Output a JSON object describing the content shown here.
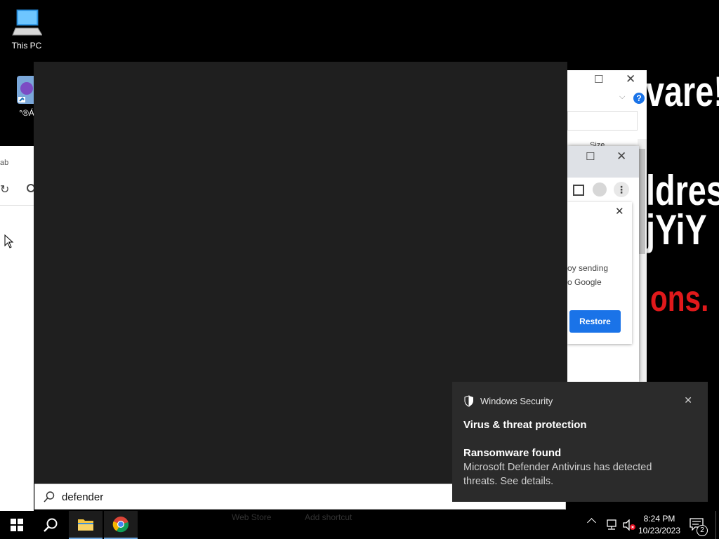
{
  "desktop": {
    "icons": [
      {
        "label": "This PC"
      },
      {
        "label": "°®Á"
      }
    ]
  },
  "wallpaper": {
    "lines": [
      "vare!",
      "ldres",
      "jYiY",
      "ons."
    ]
  },
  "background_windows": {
    "explorer_partial": {
      "column_size": "Size"
    },
    "chrome_partial": {
      "tab_text": "ab",
      "dialog_text_1": "oy sending",
      "dialog_text_2": "o Google",
      "restore_label": "Restore",
      "bookmarks": [
        "Web Store",
        "Add shortcut"
      ]
    }
  },
  "search": {
    "query": "defender"
  },
  "toast": {
    "app_name": "Windows Security",
    "title": "Virus & threat protection",
    "subtitle": "Ransomware found",
    "body": "Microsoft Defender Antivirus has detected threats.  See details."
  },
  "taskbar": {
    "time": "8:24 PM",
    "date": "10/23/2023",
    "notification_count": "2"
  },
  "colors": {
    "toast_bg": "#2b2b2b",
    "search_panel_bg": "#1f1f1f",
    "restore_button": "#1a73e8",
    "taskbar_accent": "#6ea6dd"
  }
}
